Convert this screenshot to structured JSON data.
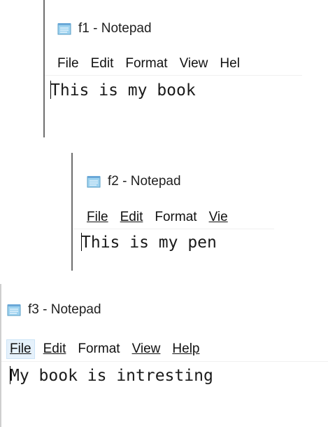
{
  "windows": [
    {
      "title": "f1 - Notepad",
      "menu": [
        "File",
        "Edit",
        "Format",
        "View",
        "Hel"
      ],
      "content": "This is my book"
    },
    {
      "title": "f2 - Notepad",
      "menu": [
        "File",
        "Edit",
        "Format",
        "Vie"
      ],
      "content": "This is my pen"
    },
    {
      "title": "f3 - Notepad",
      "menu": [
        "File",
        "Edit",
        "Format",
        "View",
        "Help"
      ],
      "content": "My book is intresting"
    }
  ],
  "icons": {
    "app": "notepad-icon"
  },
  "colors": {
    "title_text": "#1f1f1f",
    "menu_hover_bg": "#e5f1fb",
    "window_border": "#6e6e6e"
  }
}
